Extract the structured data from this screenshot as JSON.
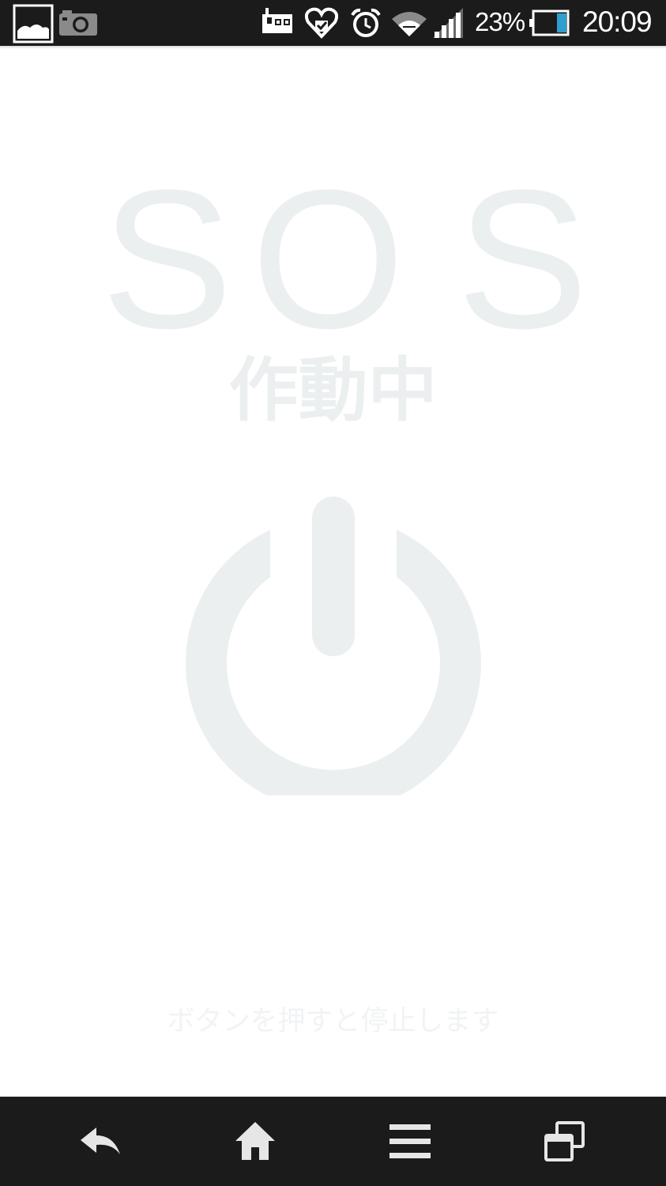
{
  "status_bar": {
    "notification_icons": [
      "gallery-icon",
      "camera-icon"
    ],
    "system_icons": [
      "tv-icon",
      "heart-check-icon",
      "alarm-icon",
      "wifi-icon",
      "cell-signal-icon"
    ],
    "battery_percent": "23%",
    "battery_level": 0.23,
    "time": "20:09"
  },
  "main": {
    "title_letters": [
      "S",
      "O",
      "S"
    ],
    "status_label": "作動中",
    "power_icon": "power-icon",
    "hint": "ボタンを押すと停止します"
  },
  "nav_bar": {
    "buttons": [
      "back-icon",
      "home-icon",
      "menu-icon",
      "recent-apps-icon"
    ]
  },
  "colors": {
    "bar_background": "#1b1b1b",
    "content_background": "#ffffff",
    "faint_gray": "#eceff0",
    "battery_fill": "#2f9fd0"
  }
}
